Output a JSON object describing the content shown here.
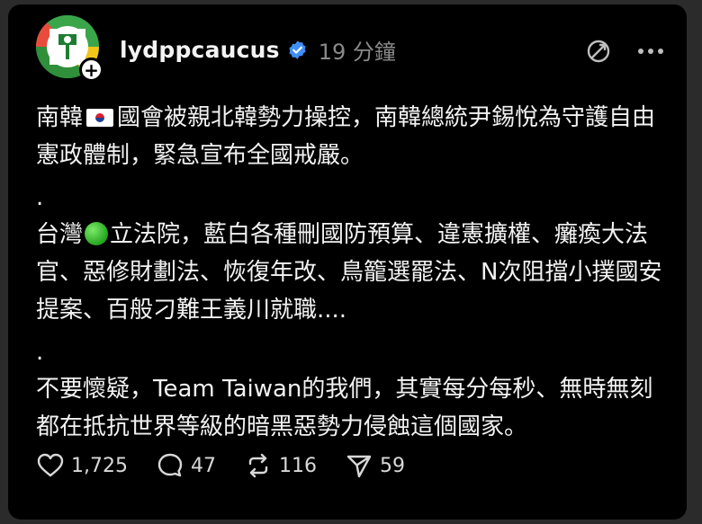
{
  "post": {
    "username": "lydppcaucus",
    "timestamp": "19 分鐘",
    "paragraph1_part1": "南韓",
    "paragraph1_part2": "國會被親北韓勢力操控，南韓總統尹錫悅為守護自由憲政體制，緊急宣布全國戒嚴。",
    "separator1": ".",
    "paragraph2_part1": "台灣",
    "paragraph2_part2": "立法院，藍白各種刪國防預算、違憲擴權、癱瘓大法官、惡修財劃法、恢復年改、鳥籠選罷法、N次阻擋小撲國安提案、百般刁難王義川就職....",
    "separator2": ".",
    "paragraph3": "不要懷疑，Team Taiwan的我們，其實每分每秒、無時無刻都在抵抗世界等級的暗黑惡勢力侵蝕這個國家。"
  },
  "stats": {
    "likes": "1,725",
    "comments": "47",
    "reposts": "116",
    "shares": "59"
  },
  "icons": {
    "verified": "verified-badge-icon",
    "follow": "plus-icon",
    "translate": "translate-icon",
    "more": "more-icon",
    "like": "heart-icon",
    "comment": "comment-icon",
    "repost": "repost-icon",
    "share": "send-icon"
  },
  "colors": {
    "background": "#000000",
    "text": "#f2f2f2",
    "muted": "#8a8a8a",
    "verified": "#3f8ff5"
  }
}
